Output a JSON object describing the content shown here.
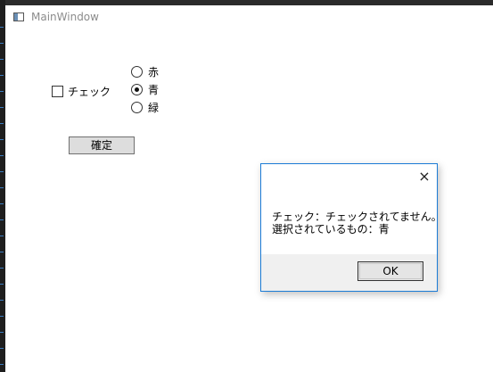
{
  "window": {
    "title": "MainWindow",
    "icon": "app-window-icon"
  },
  "checkbox": {
    "label": "チェック",
    "checked": false
  },
  "radios": [
    {
      "label": "赤",
      "checked": false
    },
    {
      "label": "青",
      "checked": true
    },
    {
      "label": "緑",
      "checked": false
    }
  ],
  "confirm_button": {
    "label": "確定"
  },
  "message_box": {
    "close_icon": "×",
    "line1": "チェック：チェックされてません。",
    "line2": "選択されているもの：青",
    "ok_label": "OK"
  },
  "colors": {
    "dialog_border": "#1c7cd6",
    "dialog_footer": "#f0f0f0",
    "button_face": "#dddddd"
  }
}
